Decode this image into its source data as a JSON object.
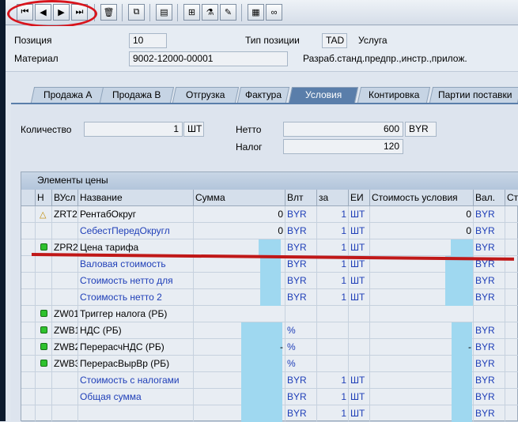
{
  "toolbar": {
    "buttons": [
      "first",
      "prev",
      "next",
      "last",
      "delete",
      "copy",
      "details",
      "hierarchy",
      "flask",
      "note",
      "calc",
      "glasses"
    ],
    "glyphs": {
      "first": "⏮",
      "prev": "◀",
      "next": "▶",
      "last": "⏭",
      "delete": "🗑",
      "copy": "⧉",
      "details": "▤",
      "hierarchy": "⊞",
      "flask": "⚗",
      "note": "✎",
      "calc": "▦",
      "glasses": "∞"
    }
  },
  "header": {
    "position_label": "Позиция",
    "position_value": "10",
    "item_type_label": "Тип позиции",
    "item_type_value": "TAD",
    "item_type_desc": "Услуга",
    "material_label": "Материал",
    "material_value": "9002-12000-00001",
    "material_desc": "Разраб.станд.предпр.,инстр.,прилож."
  },
  "tabs": [
    "Продажа А",
    "Продажа В",
    "Отгрузка",
    "Фактура",
    "Условия",
    "Контировка",
    "Партии поставки"
  ],
  "active_tab": "Условия",
  "conditions": {
    "qty_label": "Количество",
    "qty_value": "1",
    "qty_unit": "ШТ",
    "net_label": "Нетто",
    "net_value": "600",
    "net_currency": "BYR",
    "tax_label": "Налог",
    "tax_value": "120"
  },
  "grid": {
    "title": "Элементы цены",
    "headers": [
      "Н",
      "ВУсл",
      "Название",
      "Сумма",
      "Влт",
      "за",
      "ЕИ",
      "Стоимость условия",
      "Вал.",
      "Ст"
    ],
    "rows": [
      {
        "status": "warn",
        "code": "ZRT2",
        "name": "РентабОкруг",
        "amount": "0",
        "curr": "BYR",
        "per": "1",
        "uom": "ШТ",
        "value": "0",
        "vcurr": "BYR",
        "blue": false
      },
      {
        "status": "",
        "code": "",
        "name": "СебестПередОкругл",
        "amount": "0",
        "curr": "BYR",
        "per": "1",
        "uom": "ШТ",
        "value": "0",
        "vcurr": "BYR",
        "blue": true
      },
      {
        "status": "green",
        "code": "ZPR2",
        "name": "Цена тарифа",
        "amount": "",
        "curr": "BYR",
        "per": "1",
        "uom": "ШТ",
        "value": "",
        "vcurr": "BYR",
        "blue": false
      },
      {
        "status": "",
        "code": "",
        "name": "Валовая стоимость",
        "amount": "",
        "curr": "BYR",
        "per": "1",
        "uom": "ШТ",
        "value": "",
        "vcurr": "BYR",
        "blue": true
      },
      {
        "status": "",
        "code": "",
        "name": "Стоимость нетто для",
        "amount": "",
        "curr": "BYR",
        "per": "1",
        "uom": "ШТ",
        "value": "",
        "vcurr": "BYR",
        "blue": true
      },
      {
        "status": "",
        "code": "",
        "name": "Стоимость нетто 2",
        "amount": "",
        "curr": "BYR",
        "per": "1",
        "uom": "ШТ",
        "value": "",
        "vcurr": "BYR",
        "blue": true
      },
      {
        "status": "green",
        "code": "ZW01",
        "name": "Триггер налога (РБ)",
        "amount": "",
        "curr": "",
        "per": "",
        "uom": "",
        "value": "",
        "vcurr": "",
        "blue": false
      },
      {
        "status": "green",
        "code": "ZWB1",
        "name": "НДС (РБ)",
        "amount": "",
        "curr": "%",
        "per": "",
        "uom": "",
        "value": "",
        "vcurr": "BYR",
        "blue": false
      },
      {
        "status": "green",
        "code": "ZWB2",
        "name": "ПерерасчНДС (РБ)",
        "amount": "-",
        "curr": "%",
        "per": "",
        "uom": "",
        "value": "-",
        "vcurr": "BYR",
        "blue": false
      },
      {
        "status": "green",
        "code": "ZWB3",
        "name": "ПерерасВырВр (РБ)",
        "amount": "",
        "curr": "%",
        "per": "",
        "uom": "",
        "value": "",
        "vcurr": "BYR",
        "blue": false
      },
      {
        "status": "",
        "code": "",
        "name": "Стоимость с налогами",
        "amount": "",
        "curr": "BYR",
        "per": "1",
        "uom": "ШТ",
        "value": "",
        "vcurr": "BYR",
        "blue": true
      },
      {
        "status": "",
        "code": "",
        "name": "Общая сумма",
        "amount": "",
        "curr": "BYR",
        "per": "1",
        "uom": "ШТ",
        "value": "",
        "vcurr": "BYR",
        "blue": true
      },
      {
        "status": "",
        "code": "",
        "name": "",
        "amount": "",
        "curr": "BYR",
        "per": "1",
        "uom": "ШТ",
        "value": "",
        "vcurr": "BYR",
        "blue": false
      }
    ]
  }
}
